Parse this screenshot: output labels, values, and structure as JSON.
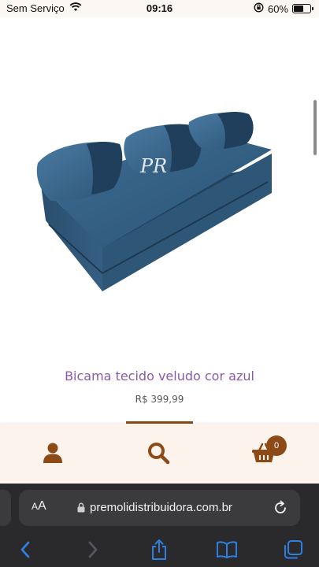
{
  "status_bar": {
    "carrier": "Sem Serviço",
    "time": "09:16",
    "battery_percent": "60%",
    "battery_level": 0.6
  },
  "product": {
    "image_alt": "Bicama tecido veludo cor azul",
    "watermark": "PR",
    "title": "Bicama tecido veludo cor azul",
    "price": "R$ 399,99"
  },
  "app_nav": {
    "items": [
      {
        "icon": "user-icon"
      },
      {
        "icon": "search-icon"
      },
      {
        "icon": "cart-icon"
      }
    ],
    "cart_count": "0",
    "accent_color": "#8b4a16"
  },
  "browser": {
    "text_size_label": "AA",
    "url": "premolidistribuidora.com.br"
  },
  "colors": {
    "title": "#8a5aa8",
    "sofa": "#2f5a7d",
    "browser_bg": "#2a2a2d",
    "browser_icons": "#2f7fe0"
  }
}
